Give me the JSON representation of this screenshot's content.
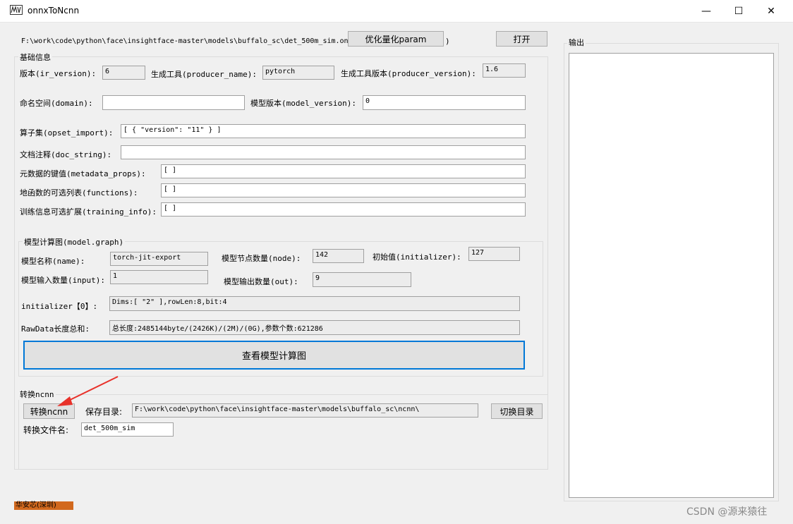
{
  "window": {
    "title": "onnxToNcnn",
    "minimize": "—",
    "maximize": "☐",
    "close": "✕"
  },
  "top": {
    "path_text": "F:\\work\\code\\python\\face\\insightface-master\\models\\buffalo_sc\\det_500m_sim.onn",
    "quantize_button": "优化量化param",
    "close_paren": ")",
    "open_button": "打开"
  },
  "basic": {
    "title": "基础信息",
    "ir_version_label": "版本(ir_version):",
    "ir_version": "6",
    "producer_name_label": "生成工具(producer_name):",
    "producer_name": "pytorch",
    "producer_version_label": "生成工具版本(producer_version):",
    "producer_version": "1.6",
    "domain_label": "命名空间(domain):",
    "domain": "",
    "model_version_label": "模型版本(model_version):",
    "model_version": "0",
    "opset_label": "算子集(opset_import):",
    "opset": "[ { \"version\": \"11\" } ]",
    "doc_string_label": "文档注释(doc_string):",
    "doc_string": "",
    "metadata_label": "元数据的键值(metadata_props):",
    "metadata": "[ ]",
    "functions_label": "地函数的可选列表(functions):",
    "functions": "[ ]",
    "training_label": "训练信息可选扩展(training_info):",
    "training": "[ ]"
  },
  "graph": {
    "title": "模型计算图(model.graph)",
    "name_label": "模型名称(name):",
    "name": "torch-jit-export",
    "node_label": "模型节点数量(node):",
    "node": "142",
    "initializer_label": "初始值(initializer):",
    "initializer": "127",
    "input_label": "模型输入数量(input):",
    "input": "1",
    "output_label": "模型输出数量(out):",
    "output": "9",
    "init0_label": "initializer【0】:",
    "init0": "Dims:[ \"2\" ],rowLen:8,bit:4",
    "rawdata_label": "RawData长度总和:",
    "rawdata": "总长度:2485144byte/(2426K)/(2M)/(0G),参数个数:621286",
    "view_button": "查看模型计算图"
  },
  "convert": {
    "title": "转换ncnn",
    "convert_button": "转换ncnn",
    "save_dir_label": "保存目录:",
    "save_dir": "F:\\work\\code\\python\\face\\insightface-master\\models\\buffalo_sc\\ncnn\\",
    "switch_dir_button": "切换目录",
    "filename_label": "转换文件名:",
    "filename": "det_500m_sim"
  },
  "output_panel": {
    "title": "输出",
    "content": ""
  },
  "footer": {
    "company": "华安芯(深圳)",
    "watermark": "CSDN @源来猿往"
  },
  "colors": {
    "accent_border": "#0078d7",
    "arrow": "#e8312a",
    "footer_bg": "#d2691e"
  }
}
